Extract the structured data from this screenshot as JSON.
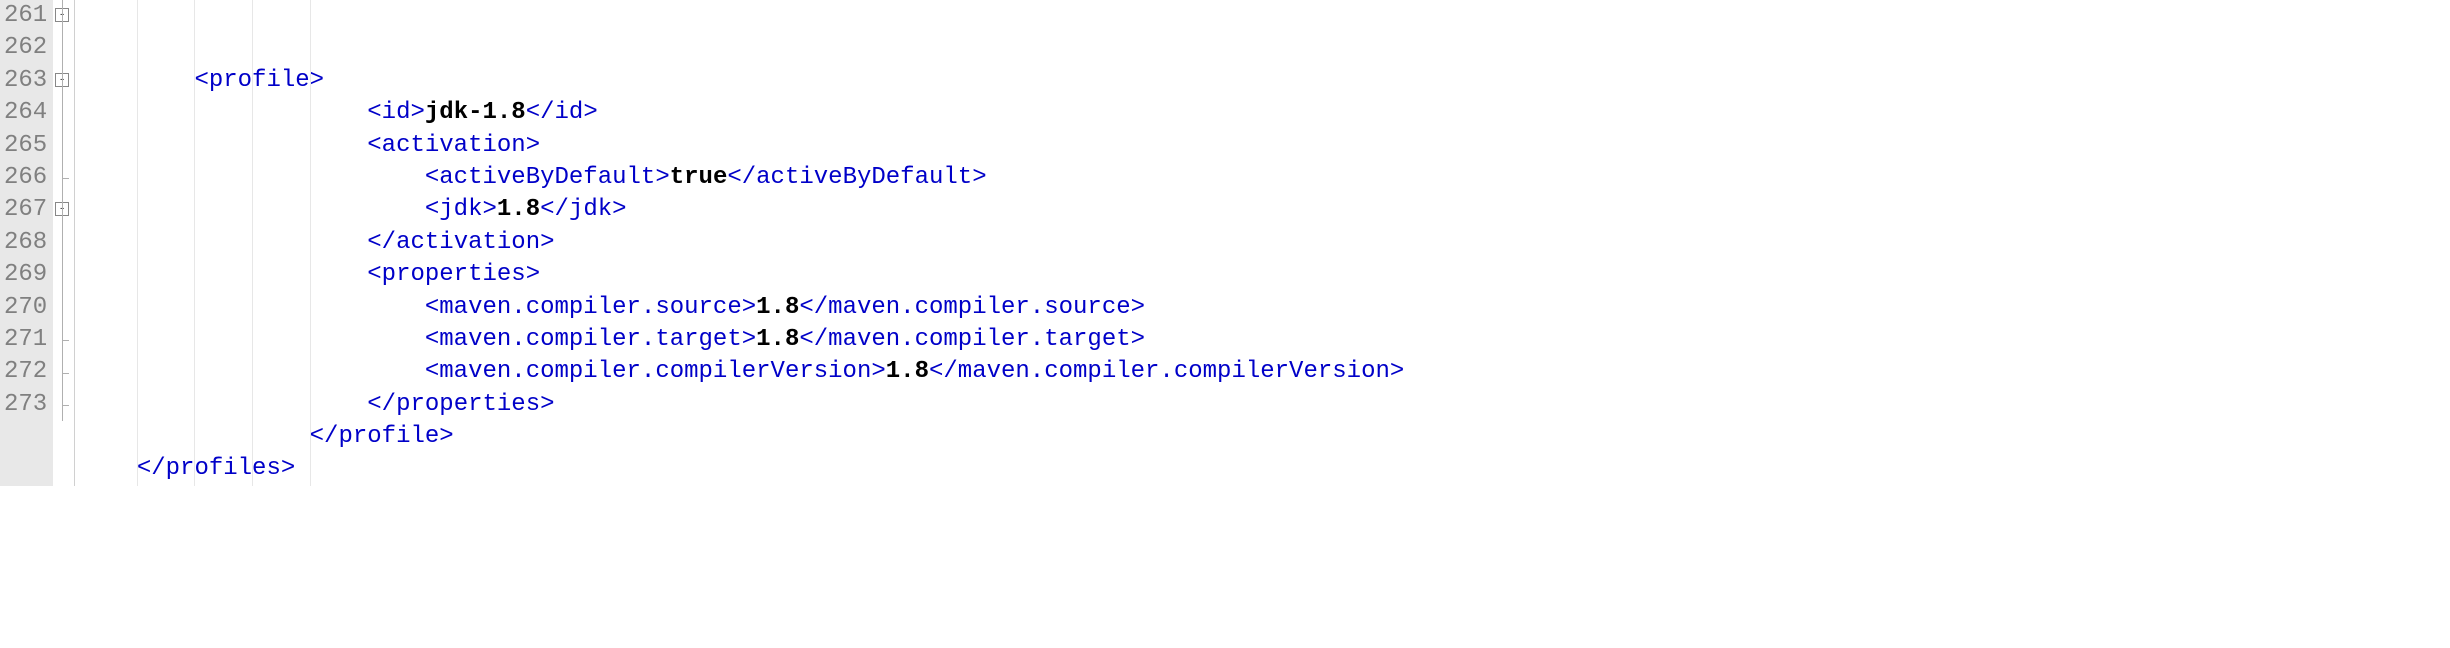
{
  "lines": [
    {
      "num": "261",
      "fold": "open",
      "indent": 2,
      "parts": [
        {
          "t": "angle",
          "v": "<"
        },
        {
          "t": "tag",
          "v": "profile"
        },
        {
          "t": "angle",
          "v": ">"
        }
      ]
    },
    {
      "num": "262",
      "fold": "line",
      "indent": 5,
      "parts": [
        {
          "t": "angle",
          "v": "<"
        },
        {
          "t": "tag",
          "v": "id"
        },
        {
          "t": "angle",
          "v": ">"
        },
        {
          "t": "txt",
          "v": "jdk-1.8"
        },
        {
          "t": "angle",
          "v": "</"
        },
        {
          "t": "tag",
          "v": "id"
        },
        {
          "t": "angle",
          "v": ">"
        }
      ]
    },
    {
      "num": "263",
      "fold": "open",
      "indent": 5,
      "parts": [
        {
          "t": "angle",
          "v": "<"
        },
        {
          "t": "tag",
          "v": "activation"
        },
        {
          "t": "angle",
          "v": ">"
        }
      ]
    },
    {
      "num": "264",
      "fold": "line",
      "indent": 6,
      "parts": [
        {
          "t": "angle",
          "v": "<"
        },
        {
          "t": "tag",
          "v": "activeByDefault"
        },
        {
          "t": "angle",
          "v": ">"
        },
        {
          "t": "txt",
          "v": "true"
        },
        {
          "t": "angle",
          "v": "</"
        },
        {
          "t": "tag",
          "v": "activeByDefault"
        },
        {
          "t": "angle",
          "v": ">"
        }
      ]
    },
    {
      "num": "265",
      "fold": "line",
      "indent": 6,
      "parts": [
        {
          "t": "angle",
          "v": "<"
        },
        {
          "t": "tag",
          "v": "jdk"
        },
        {
          "t": "angle",
          "v": ">"
        },
        {
          "t": "txt",
          "v": "1.8"
        },
        {
          "t": "angle",
          "v": "</"
        },
        {
          "t": "tag",
          "v": "jdk"
        },
        {
          "t": "angle",
          "v": ">"
        }
      ]
    },
    {
      "num": "266",
      "fold": "tick",
      "indent": 5,
      "parts": [
        {
          "t": "angle",
          "v": "</"
        },
        {
          "t": "tag",
          "v": "activation"
        },
        {
          "t": "angle",
          "v": ">"
        }
      ]
    },
    {
      "num": "267",
      "fold": "open",
      "indent": 5,
      "parts": [
        {
          "t": "angle",
          "v": "<"
        },
        {
          "t": "tag",
          "v": "properties"
        },
        {
          "t": "angle",
          "v": ">"
        }
      ]
    },
    {
      "num": "268",
      "fold": "line",
      "indent": 6,
      "parts": [
        {
          "t": "angle",
          "v": "<"
        },
        {
          "t": "tag",
          "v": "maven.compiler.source"
        },
        {
          "t": "angle",
          "v": ">"
        },
        {
          "t": "txt",
          "v": "1.8"
        },
        {
          "t": "angle",
          "v": "</"
        },
        {
          "t": "tag",
          "v": "maven.compiler.source"
        },
        {
          "t": "angle",
          "v": ">"
        }
      ]
    },
    {
      "num": "269",
      "fold": "line",
      "indent": 6,
      "parts": [
        {
          "t": "angle",
          "v": "<"
        },
        {
          "t": "tag",
          "v": "maven.compiler.target"
        },
        {
          "t": "angle",
          "v": ">"
        },
        {
          "t": "txt",
          "v": "1.8"
        },
        {
          "t": "angle",
          "v": "</"
        },
        {
          "t": "tag",
          "v": "maven.compiler.target"
        },
        {
          "t": "angle",
          "v": ">"
        }
      ]
    },
    {
      "num": "270",
      "fold": "line",
      "indent": 6,
      "parts": [
        {
          "t": "angle",
          "v": "<"
        },
        {
          "t": "tag",
          "v": "maven.compiler.compilerVersion"
        },
        {
          "t": "angle",
          "v": ">"
        },
        {
          "t": "txt",
          "v": "1.8"
        },
        {
          "t": "angle",
          "v": "</"
        },
        {
          "t": "tag",
          "v": "maven.compiler.compilerVersion"
        },
        {
          "t": "angle",
          "v": ">"
        }
      ]
    },
    {
      "num": "271",
      "fold": "tick",
      "indent": 5,
      "parts": [
        {
          "t": "angle",
          "v": "</"
        },
        {
          "t": "tag",
          "v": "properties"
        },
        {
          "t": "angle",
          "v": ">"
        }
      ]
    },
    {
      "num": "272",
      "fold": "tick",
      "indent": 4,
      "parts": [
        {
          "t": "angle",
          "v": "</"
        },
        {
          "t": "tag",
          "v": "profile"
        },
        {
          "t": "angle",
          "v": ">"
        }
      ]
    },
    {
      "num": "273",
      "fold": "tick",
      "indent": 1,
      "parts": [
        {
          "t": "angle",
          "v": "</"
        },
        {
          "t": "tag",
          "v": "profiles"
        },
        {
          "t": "angle",
          "v": ">"
        }
      ]
    }
  ],
  "indent_unit": "    ",
  "guide_positions": [
    1,
    2,
    3,
    4
  ]
}
